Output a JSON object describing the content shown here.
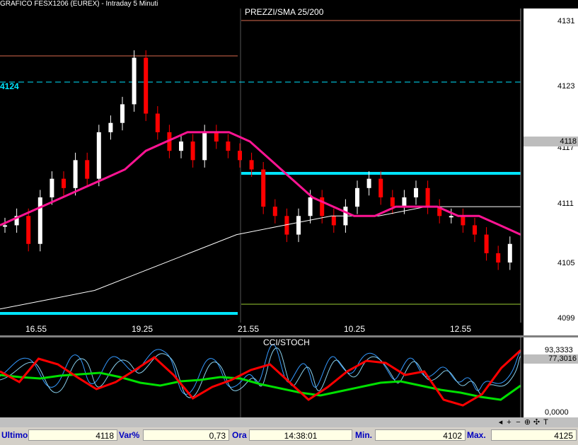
{
  "window": {
    "title": "GRAFICO FESX1206 (EUREX) - Intraday 5 Minuti"
  },
  "price_panel": {
    "title": "PREZZI/SMA 25/200",
    "level_label": "4124",
    "y_ticks": [
      "4131",
      "4123",
      "4117",
      "4111",
      "4105",
      "4099"
    ],
    "last_price_marker": "4118",
    "x_ticks": [
      "16.55",
      "19.25",
      "21.55",
      "10.25",
      "12.55"
    ]
  },
  "indicator_panel": {
    "title": "CCI/STOCH",
    "y_ticks": [
      "93,3333",
      "77,3016",
      "0,0000"
    ]
  },
  "toolbar": {
    "buttons": [
      "+",
      "−",
      "⊕",
      "✣",
      "T"
    ]
  },
  "statusbar": {
    "ultimo_label": "Ultimo",
    "ultimo_value": "4118",
    "var_label": "Var%",
    "var_value": "0,73",
    "ora_label": "Ora",
    "ora_value": "14:38:01",
    "min_label": "Min.",
    "min_value": "4102",
    "max_label": "Max.",
    "max_value": "4125"
  },
  "colors": {
    "background": "#000000",
    "sma25": "#ff1493",
    "sma200": "#ffffff",
    "level_line": "#00ffff",
    "cci": "#ff0000",
    "stoch": "#00e000",
    "osc": "#3399ff",
    "up_candle": "#ffffff",
    "down_candle": "#ff0000"
  },
  "chart_data": [
    {
      "type": "candlestick",
      "title": "PREZZI/SMA 25/200",
      "y_range": [
        4099,
        4131
      ],
      "series": [
        {
          "name": "PREZZI",
          "values": [
            4109,
            4110,
            4107,
            4112,
            4114,
            4113,
            4116,
            4114,
            4119,
            4120,
            4122,
            4127,
            4121,
            4119,
            4117,
            4118,
            4116,
            4119,
            4118,
            4117,
            4116,
            4115,
            4111,
            4110,
            4108,
            4110,
            4112,
            4110,
            4109,
            4111,
            4113,
            4114,
            4112,
            4111,
            4112,
            4113,
            4111,
            4110,
            4110,
            4109,
            4108,
            4106,
            4105,
            4107
          ]
        },
        {
          "name": "SMA 25",
          "values": [
            4109,
            4110,
            4111,
            4112,
            4113,
            4114,
            4115,
            4117,
            4118,
            4119,
            4119,
            4119,
            4118,
            4116,
            4114,
            4112,
            4111,
            4110,
            4110,
            4111,
            4111,
            4111,
            4110,
            4110,
            4109,
            4108
          ]
        },
        {
          "name": "SMA 200",
          "values": [
            4100,
            4101,
            4102,
            4104,
            4106,
            4108,
            4109,
            4110,
            4110,
            4111,
            4111,
            4111
          ]
        }
      ],
      "levels": [
        4124,
        4114.5,
        4099.5,
        4129
      ]
    },
    {
      "type": "line",
      "title": "CCI/STOCH",
      "y_range": [
        0,
        100
      ],
      "series": [
        {
          "name": "CCI",
          "values": [
            60,
            45,
            78,
            70,
            52,
            35,
            45,
            62,
            80,
            55,
            22,
            38,
            48,
            62,
            70,
            45,
            20,
            38,
            60,
            75,
            72,
            55,
            60,
            20,
            12,
            28,
            65,
            90
          ]
        },
        {
          "name": "STOCH",
          "values": [
            55,
            52,
            50,
            54,
            56,
            58,
            52,
            44,
            40,
            46,
            48,
            52,
            50,
            42,
            36,
            30,
            26,
            32,
            38,
            44,
            46,
            40,
            34,
            30,
            24,
            20,
            40
          ]
        }
      ]
    }
  ]
}
